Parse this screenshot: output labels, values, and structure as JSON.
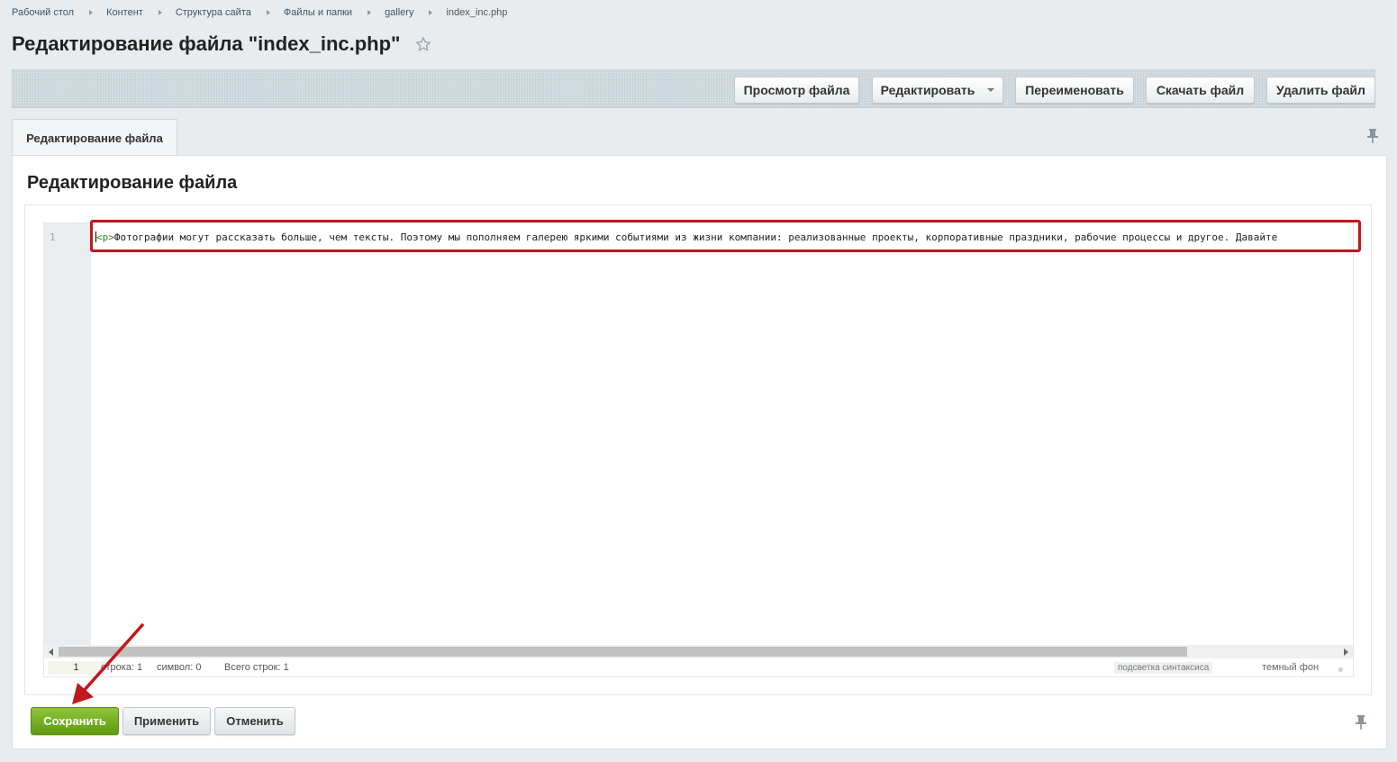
{
  "breadcrumbs": [
    "Рабочий стол",
    "Контент",
    "Структура сайта",
    "Файлы и папки",
    "gallery",
    "index_inc.php"
  ],
  "page_title": "Редактирование файла \"index_inc.php\"",
  "toolbar": {
    "view_label": "Просмотр файла",
    "edit_label": "Редактировать",
    "rename_label": "Переименовать",
    "download_label": "Скачать файл",
    "delete_label": "Удалить файл"
  },
  "tab_label": "Редактирование файла",
  "section_title": "Редактирование файла",
  "editor": {
    "line_number": "1",
    "code_tag": "<p>",
    "code_text": "Фотографии могут рассказать больше, чем тексты. Поэтому мы пополняем галерею яркими событиями из жизни компании: реализованные проекты, корпоративные праздники, рабочие процессы и другое. Давайте"
  },
  "status": {
    "current_line": "1",
    "row_label": "строка: 1",
    "symbol_label": "символ: 0",
    "total_label": "Всего строк: 1",
    "syntax_label": "подсветка синтаксиса",
    "dark_label": "темный фон"
  },
  "footer": {
    "save_label": "Сохранить",
    "apply_label": "Применить",
    "cancel_label": "Отменить"
  },
  "colors": {
    "annotation_red": "#c0181c",
    "save_green": "#6aa51b"
  }
}
